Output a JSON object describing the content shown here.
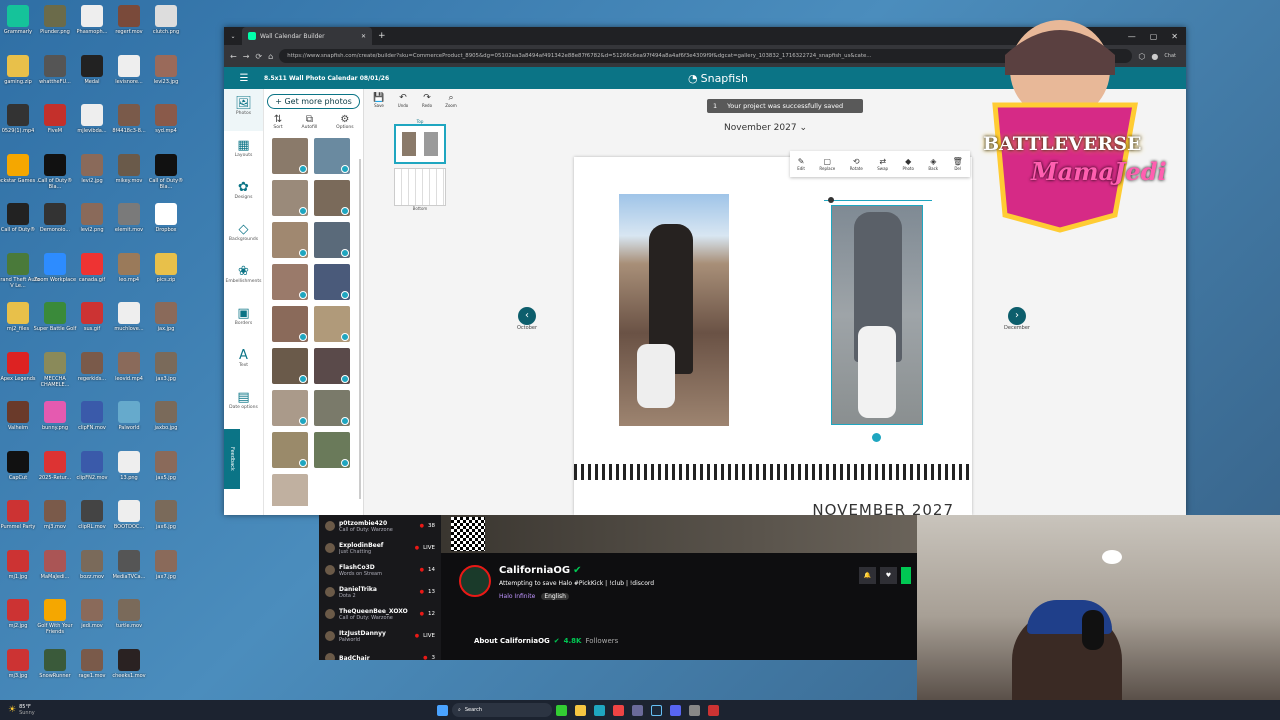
{
  "desktop": {
    "icons": [
      {
        "label": "Grammarly",
        "color": "#15c39a"
      },
      {
        "label": "Plunder.png",
        "color": "#6b6b4a"
      },
      {
        "label": "Phasmoph...",
        "color": "#eee"
      },
      {
        "label": "regerf.mov",
        "color": "#7a4a3a"
      },
      {
        "label": "clutch.png",
        "color": "#ddd"
      },
      {
        "label": "gaming.zip",
        "color": "#e8c04a"
      },
      {
        "label": "whattheFU...",
        "color": "#555"
      },
      {
        "label": "Medal",
        "color": "#222"
      },
      {
        "label": "levisnore...",
        "color": "#eee"
      },
      {
        "label": "levi23.jpg",
        "color": "#9a6a5a"
      },
      {
        "label": "0529(1).mp4",
        "color": "#333"
      },
      {
        "label": "FiveM",
        "color": "#c4302b"
      },
      {
        "label": "mjlevibda...",
        "color": "#eee"
      },
      {
        "label": "8f4418c3-8...",
        "color": "#7a5a4a"
      },
      {
        "label": "syd.mp4",
        "color": "#8a5a4a"
      },
      {
        "label": "Rockstar Games ...",
        "color": "#f5a700"
      },
      {
        "label": "Call of Duty® Bla...",
        "color": "#111"
      },
      {
        "label": "levi2.jpg",
        "color": "#8a6a5a"
      },
      {
        "label": "mikey.mov",
        "color": "#6a5a4a"
      },
      {
        "label": "Call of Duty® Bla...",
        "color": "#111"
      },
      {
        "label": "Call of Duty®",
        "color": "#222"
      },
      {
        "label": "Demonolo...",
        "color": "#333"
      },
      {
        "label": "levi2.png",
        "color": "#8a6a5a"
      },
      {
        "label": "elemit.mov",
        "color": "#7a7a7a"
      },
      {
        "label": "Dropbox",
        "color": "#fff"
      },
      {
        "label": "Grand Theft Auto V Le...",
        "color": "#4a7a3a"
      },
      {
        "label": "Zoom Workplace",
        "color": "#2d8cff"
      },
      {
        "label": "canada.gif",
        "color": "#e33"
      },
      {
        "label": "leo.mp4",
        "color": "#9a7a5a"
      },
      {
        "label": "pics.zip",
        "color": "#e8c04a"
      },
      {
        "label": "mj2_files",
        "color": "#e8c04a"
      },
      {
        "label": "Super Battle Golf",
        "color": "#3a8a3a"
      },
      {
        "label": "sus.gif",
        "color": "#c33"
      },
      {
        "label": "muchlove...",
        "color": "#eee"
      },
      {
        "label": "jax.jpg",
        "color": "#8a6a5a"
      },
      {
        "label": "Apex Legends",
        "color": "#d22"
      },
      {
        "label": "MECCHA CHAMELE...",
        "color": "#8a8a5a"
      },
      {
        "label": "regerkids...",
        "color": "#7a5a4a"
      },
      {
        "label": "leovid.mp4",
        "color": "#8a6a5a"
      },
      {
        "label": "jax3.jpg",
        "color": "#7a6a5a"
      },
      {
        "label": "Valheim",
        "color": "#6a3a2a"
      },
      {
        "label": "bunny.png",
        "color": "#e55ab0"
      },
      {
        "label": "clipFN.mov",
        "color": "#3a5aaa"
      },
      {
        "label": "Palworld",
        "color": "#6ac"
      },
      {
        "label": "jaxbo.jpg",
        "color": "#7a6a5a"
      },
      {
        "label": "CapCut",
        "color": "#111"
      },
      {
        "label": "2025-Retur...",
        "color": "#d33"
      },
      {
        "label": "clipFN2.mov",
        "color": "#3a5aaa"
      },
      {
        "label": "13.png",
        "color": "#eee"
      },
      {
        "label": "jax5.jpg",
        "color": "#8a6a5a"
      },
      {
        "label": "Pummel Party",
        "color": "#c33"
      },
      {
        "label": "mj3.mov",
        "color": "#7a5a4a"
      },
      {
        "label": "clipRL.mov",
        "color": "#444"
      },
      {
        "label": "BOOTDOC...",
        "color": "#eee"
      },
      {
        "label": "jax6.jpg",
        "color": "#7a6a5a"
      },
      {
        "label": "mj1.jpg",
        "color": "#c33"
      },
      {
        "label": "MaMaJedi...",
        "color": "#a55"
      },
      {
        "label": "bozz.mov",
        "color": "#7a6a5a"
      },
      {
        "label": "MediaTVCa...",
        "color": "#555"
      },
      {
        "label": "jax7.jpg",
        "color": "#8a6a5a"
      },
      {
        "label": "mj2.jpg",
        "color": "#c33"
      },
      {
        "label": "Golf With Your Friends",
        "color": "#f5a700"
      },
      {
        "label": "jedi.mov",
        "color": "#8a6a5a"
      },
      {
        "label": "turtle.mov",
        "color": "#7a6a5a"
      },
      {
        "label": "",
        "color": "transparent"
      },
      {
        "label": "mj3.jpg",
        "color": "#c33"
      },
      {
        "label": "SnowRunner",
        "color": "#3a5a3a"
      },
      {
        "label": "rage1.mov",
        "color": "#7a5a4a"
      },
      {
        "label": "cheeks1.mov",
        "color": "#2a2222"
      },
      {
        "label": "",
        "color": "transparent"
      }
    ]
  },
  "browser": {
    "tab_title": "Wall Calendar Builder",
    "url": "https://www.snapfish.com/create/builder?sku=CommerceProduct_8905&dg=05102ea3a8494af491342e88e87f6782&d=51266c6ea97f494a8a4af6f3e4309f9f&dgcat=gallery_103832_1716322724_snapfish_us&cate...",
    "chat_label": "Chat"
  },
  "app": {
    "project_title": "8.5x11 Wall Photo Calendar  08/01/26",
    "brand": "Snapfish",
    "toast": "Your project was successfully saved",
    "toast_count": "1",
    "toolbar": [
      {
        "label": "Save",
        "glyph": "💾"
      },
      {
        "label": "Undo",
        "glyph": "↶"
      },
      {
        "label": "Redo",
        "glyph": "↷"
      },
      {
        "label": "Zoom",
        "glyph": "⌕"
      }
    ],
    "sidebar": [
      {
        "label": "Photos",
        "glyph": "🖼"
      },
      {
        "label": "Layouts",
        "glyph": "▦"
      },
      {
        "label": "Designs",
        "glyph": "✿"
      },
      {
        "label": "Backgrounds",
        "glyph": "◇"
      },
      {
        "label": "Embellishments",
        "glyph": "❀"
      },
      {
        "label": "Borders",
        "glyph": "▣"
      },
      {
        "label": "Text",
        "glyph": "A"
      },
      {
        "label": "Date options",
        "glyph": "▤"
      }
    ],
    "feedback": "Feedback",
    "photos_button": "+ Get more photos",
    "photo_actions": [
      {
        "label": "Sort",
        "glyph": "⇅"
      },
      {
        "label": "Autofill",
        "glyph": "⧉"
      },
      {
        "label": "Options",
        "glyph": "⚙"
      }
    ],
    "pages": {
      "top": "Top",
      "bottom": "Bottom"
    },
    "month_selector": "November 2027",
    "prev_month": "October",
    "next_month": "December",
    "photo_tools": [
      {
        "label": "Edit",
        "glyph": "✎"
      },
      {
        "label": "Replace",
        "glyph": "▢"
      },
      {
        "label": "Rotate",
        "glyph": "⟲"
      },
      {
        "label": "Swap",
        "glyph": "⇄"
      },
      {
        "label": "Photo",
        "glyph": "◆"
      },
      {
        "label": "Back",
        "glyph": "◈"
      },
      {
        "label": "Del",
        "glyph": "🗑"
      }
    ],
    "calendar_month_title": "NOVEMBER 2027"
  },
  "overlay_logo": {
    "line1": "BATTLEVERSE",
    "line2": "MamaJedi"
  },
  "stream": {
    "channel": "CaliforniaOG",
    "title": "Attempting to save Halo #PickKick | !club | !discord",
    "game": "Halo Infinite",
    "language": "English",
    "about": "About CaliforniaOG",
    "followers": "4.8K",
    "followers_label": "Followers",
    "viewers": [
      {
        "name": "p0tzombie420",
        "game": "Call of Duty: Warzone",
        "count": "38"
      },
      {
        "name": "ExplodinBeef",
        "game": "Just Chatting",
        "count": "LIVE"
      },
      {
        "name": "FlashCo3D",
        "game": "Words on Stream",
        "count": "14"
      },
      {
        "name": "DanielTrika",
        "game": "Dota 2",
        "count": "13"
      },
      {
        "name": "TheQueenBee_XOXO",
        "game": "Call of Duty: Warzone",
        "count": "12"
      },
      {
        "name": "ItzJustDannyy",
        "game": "Palworld",
        "count": "LIVE"
      },
      {
        "name": "BadChair",
        "game": "",
        "count": "3"
      }
    ]
  },
  "taskbar": {
    "weather_temp": "85°F",
    "weather_desc": "Sunny",
    "search": "Search"
  },
  "colors": {
    "teal": "#0b7486",
    "accent": "#1fa6c0",
    "live": "#e91916",
    "verified": "#00c853"
  }
}
